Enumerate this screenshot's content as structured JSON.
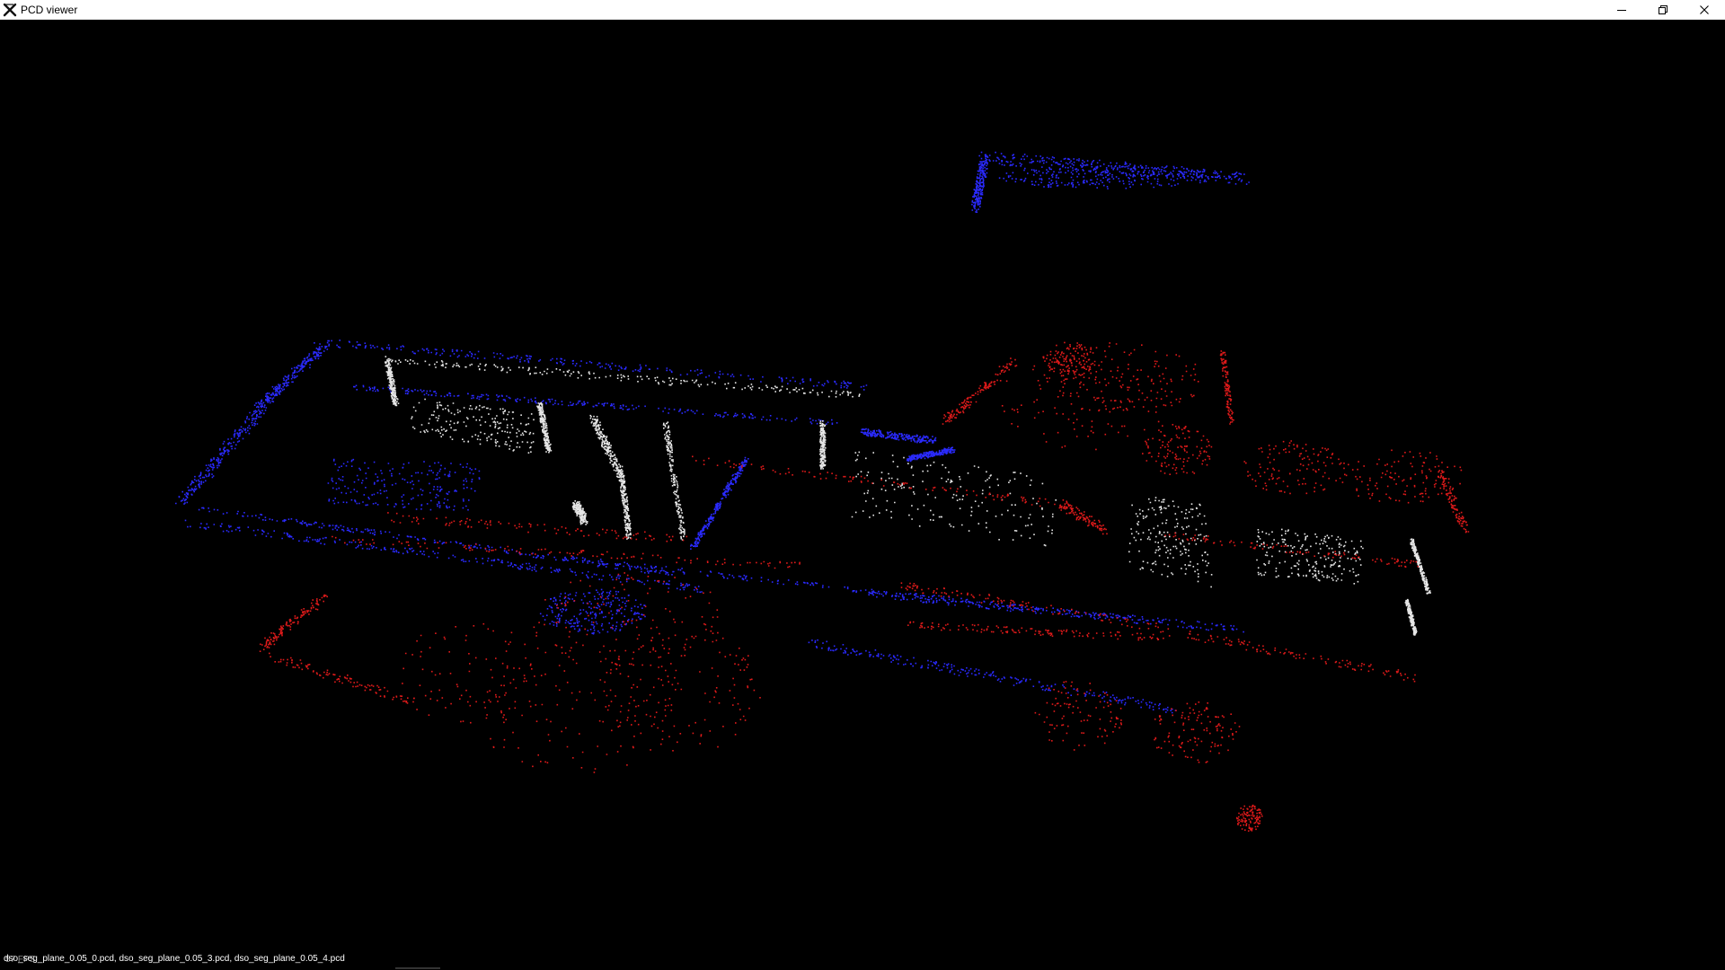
{
  "window": {
    "title": "PCD viewer",
    "icon": "pcl-x-icon",
    "controls": {
      "minimize_icon": "minimize-icon",
      "restore_icon": "restore-icon",
      "close_icon": "close-icon"
    }
  },
  "viewer": {
    "background": "#000000",
    "status_text": "dso_seg_plane_0.05_0.pcd, dso_seg_plane_0.05_3.pcd, dso_seg_plane_0.05_4.pcd",
    "fps_overlay": "57 FPS",
    "point_colors": {
      "cloud_white": "#e6e6e6",
      "cloud_blue": "#2a2aff",
      "cloud_red": "#e01a1a"
    }
  }
}
